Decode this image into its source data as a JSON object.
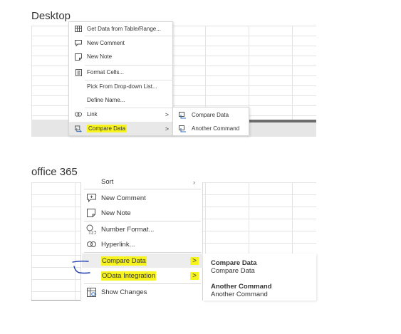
{
  "headings": {
    "desktop": "Desktop",
    "office365": "office 365"
  },
  "desktop_menu": {
    "items": [
      {
        "label": "Get Data from Table/Range...",
        "icon": "table-icon"
      },
      {
        "label": "New Comment",
        "icon": "comment-icon"
      },
      {
        "label": "New Note",
        "icon": "note-icon"
      },
      {
        "label": "Format Cells...",
        "icon": "format-cells-icon"
      },
      {
        "label": "Pick From Drop-down List...",
        "icon": ""
      },
      {
        "label": "Define Name...",
        "icon": ""
      },
      {
        "label": "Link",
        "icon": "link-icon",
        "submenu": true
      },
      {
        "label": "Compare Data",
        "icon": "compare-data-icon",
        "submenu": true,
        "highlighted": true,
        "active": true
      }
    ],
    "submenu": [
      {
        "label": "Compare Data",
        "icon": "compare-data-icon"
      },
      {
        "label": "Another Command",
        "icon": "compare-data-icon"
      }
    ]
  },
  "office_menu": {
    "partial_item": "Sort",
    "items": [
      {
        "label": "New Comment",
        "icon": "comment-icon"
      },
      {
        "label": "New Note",
        "icon": "note-icon"
      },
      {
        "label": "Number Format...",
        "icon": "number-format-icon"
      },
      {
        "label": "Hyperlink...",
        "icon": "link-icon"
      },
      {
        "label": "Compare Data",
        "submenu": true,
        "highlighted": true,
        "active": true
      },
      {
        "label": "OData Integration",
        "submenu": true,
        "highlighted": true
      },
      {
        "label": "Show Changes",
        "icon": "show-changes-icon"
      }
    ],
    "submenu": [
      {
        "title": "Compare Data",
        "description": "Compare Data"
      },
      {
        "title": "Another Command",
        "description": "Another Command"
      }
    ]
  },
  "colors": {
    "highlight": "#f6f31d",
    "pen_mark": "#1f3bb3",
    "icon_blue": "#2f6fbf"
  }
}
